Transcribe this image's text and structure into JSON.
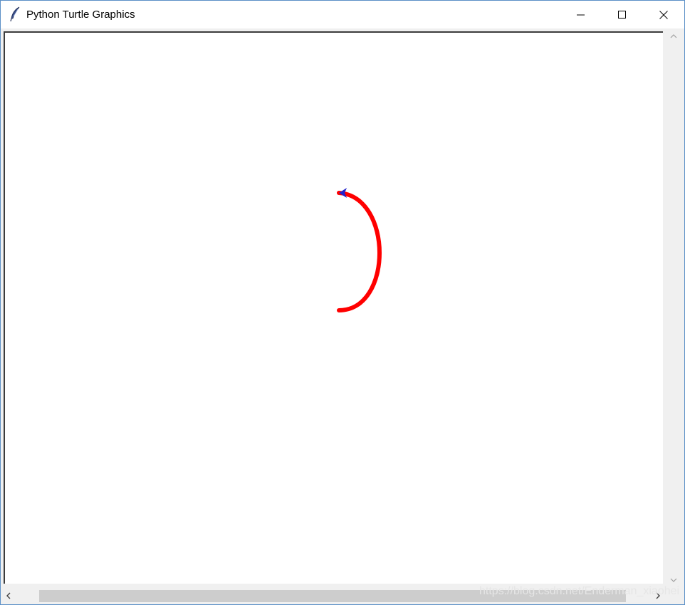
{
  "window": {
    "title": "Python Turtle Graphics",
    "app_icon": "feather-icon",
    "controls": {
      "minimize_icon": "minimize-icon",
      "maximize_icon": "maximize-icon",
      "close_icon": "close-icon"
    }
  },
  "canvas": {
    "background": "#ffffff",
    "drawing": {
      "shape": "semicircle-arc",
      "pen_color": "#ff0000",
      "turtle_color": "#2222cc",
      "turtle_icon": "turtle-arrow-icon"
    }
  },
  "scrollbars": {
    "up_icon": "scroll-up-icon",
    "down_icon": "scroll-down-icon",
    "left_icon": "scroll-left-icon",
    "right_icon": "scroll-right-icon"
  },
  "watermark": "https://blog.csdn.net/Enderman_xiaohei"
}
